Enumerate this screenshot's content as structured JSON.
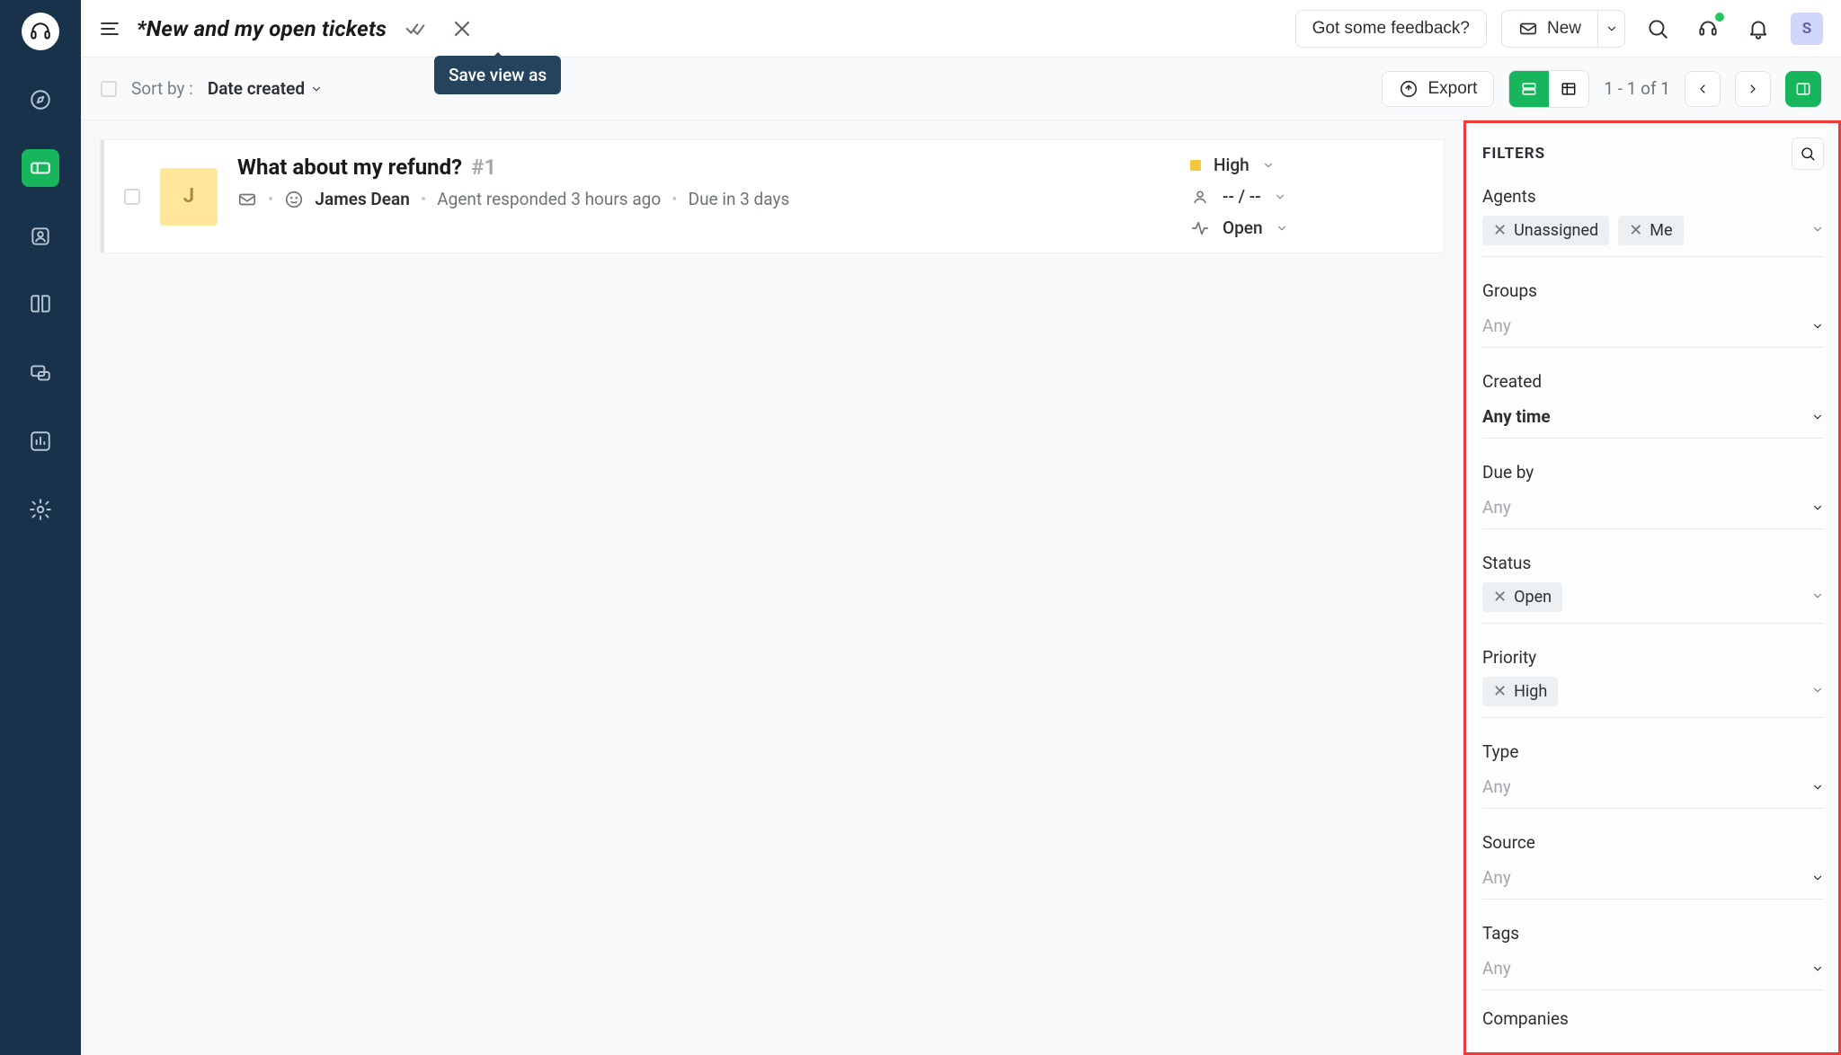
{
  "sidebar": {
    "active_index": 2
  },
  "header": {
    "title": "*New and my open tickets",
    "tooltip": "Save view as",
    "feedback_label": "Got some feedback?",
    "new_label": "New",
    "avatar_initial": "S"
  },
  "toolbar": {
    "sort_label": "Sort by :",
    "sort_value": "Date created",
    "export_label": "Export",
    "pager_text": "1 - 1 of 1"
  },
  "ticket": {
    "avatar_initial": "J",
    "title": "What about my refund?",
    "ticket_id": "#1",
    "requester": "James Dean",
    "activity": "Agent responded 3 hours ago",
    "due": "Due in 3 days",
    "priority": "High",
    "agent": "-- / --",
    "status": "Open"
  },
  "filters": {
    "title": "FILTERS",
    "agents": {
      "label": "Agents",
      "chips": [
        "Unassigned",
        "Me"
      ]
    },
    "groups": {
      "label": "Groups",
      "placeholder": "Any"
    },
    "created": {
      "label": "Created",
      "value": "Any time"
    },
    "dueby": {
      "label": "Due by",
      "placeholder": "Any"
    },
    "status": {
      "label": "Status",
      "chips": [
        "Open"
      ]
    },
    "priority": {
      "label": "Priority",
      "chips": [
        "High"
      ]
    },
    "type": {
      "label": "Type",
      "placeholder": "Any"
    },
    "source": {
      "label": "Source",
      "placeholder": "Any"
    },
    "tags": {
      "label": "Tags",
      "placeholder": "Any"
    },
    "companies": {
      "label": "Companies"
    }
  }
}
